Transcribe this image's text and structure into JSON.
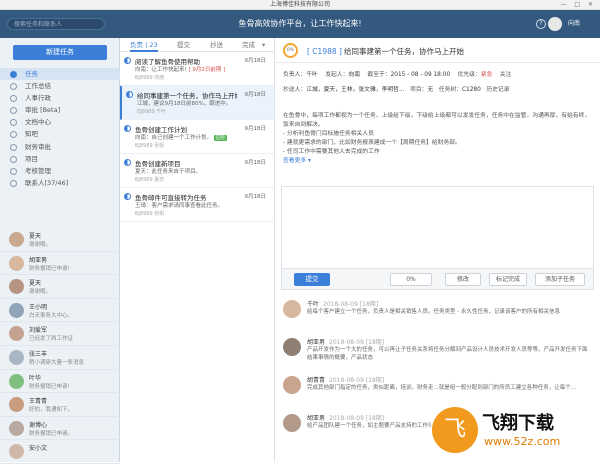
{
  "window": {
    "title": "上海博佳科技有限公司",
    "controls": "— □ ✕"
  },
  "topbar": {
    "search_placeholder": "搜索任务和联系人",
    "slogan": "鱼骨高效协作平台，让工作快起来!",
    "user_name": "向南",
    "help_glyph": "?"
  },
  "sidebar": {
    "new_task": "新建任务",
    "nav": [
      {
        "label": "任务",
        "active": true
      },
      {
        "label": "工作总结"
      },
      {
        "label": "人事行政"
      },
      {
        "label": "审批 [Beta]"
      },
      {
        "label": "文档中心"
      },
      {
        "label": "知吧"
      },
      {
        "label": "财务审批"
      },
      {
        "label": "项目"
      },
      {
        "label": "考核管理"
      },
      {
        "label": "联系人[37/46]"
      }
    ],
    "contacts": [
      {
        "name": "夏天",
        "msg": "谢谢哦。",
        "color": "#c9a98f"
      },
      {
        "name": "胡亚男",
        "msg": "财务报销已申请!",
        "color": "#d8b9a0"
      },
      {
        "name": "夏天",
        "msg": "谢谢哦。",
        "color": "#b89583"
      },
      {
        "name": "王小明",
        "msg": "白天事务大中心。",
        "color": "#8fa5b7"
      },
      {
        "name": "刘爱军",
        "msg": "已经发了两工作证",
        "color": "#c4a491"
      },
      {
        "name": "张三丰",
        "msg": "稍小调研大量一条消息",
        "color": "#a9b6c4"
      },
      {
        "name": "叶华",
        "msg": "财务报销已申请!",
        "color": "#7fbf7f"
      },
      {
        "name": "王青青",
        "msg": "好的，我通知下。",
        "color": "#c99b7f"
      },
      {
        "name": "谢博心",
        "msg": "财务报销已申请。",
        "color": "#b7a8a0"
      },
      {
        "name": "安小文",
        "msg": "",
        "color": "#d0b8a8"
      }
    ]
  },
  "tasks_panel": {
    "tabs": [
      "负责 | 23",
      "提交",
      "抄送",
      "完成"
    ],
    "tab_arrow": "▾",
    "items": [
      {
        "title": "阅读了解鱼骨使用帮助",
        "date": "9月18日",
        "sub": "向南：让工作快起来!",
        "tag": "[ 9月2日前期 ]",
        "id": "BJ8989 向南"
      },
      {
        "title": "给同事建第一个任务，协作马上开始",
        "date": "9月18日",
        "sub": "江城，建议9月18日前80%，跟进中。",
        "tag": "",
        "id": "BJ8989 千叶"
      },
      {
        "title": "鱼骨创建工作计划",
        "date": "9月18日",
        "sub": "向南：自己创建一个工作计划。",
        "tag": "已完",
        "id": "BJ8989 张帆"
      },
      {
        "title": "鱼骨创建新项目",
        "date": "9月18日",
        "sub": "夏天：此任务来自于项目。",
        "tag": "",
        "id": "BJ8989 夏天"
      },
      {
        "title": "鱼骨邮件可直接转为任务",
        "date": "9月18日",
        "sub": "王琦：客户需求请同事查看此任务。",
        "tag": "",
        "id": "BJ8989 张帆"
      }
    ]
  },
  "detail": {
    "progress": "0%",
    "code": "[ C1988 ]",
    "title": "给同事建第一个任务，协作马上开始",
    "row1": {
      "owner_l": "负责人：",
      "owner": "千叶",
      "creator_l": "发起人：",
      "creator": "向南",
      "deadline_l": "截至于：",
      "deadline": "2015 - 08 - 09 18:00",
      "priority_l": "优先级：",
      "priority": "紧急",
      "follow": "关注"
    },
    "row2": {
      "cc_l": "抄送人：",
      "cc": "江城，夏天，王林，张文雅，李明哲...",
      "project_l": "项目：",
      "project": "无",
      "rank_l": "任务树：",
      "rank": "C1280",
      "history": "历史记录"
    },
    "desc_lines": [
      "在鱼骨中，每项工作都视为一个任务，上级给下级，下级给上级都可以发发任务，任务中在监管，沟通再厚，有始有终，饭来自到解决。",
      "- 分析利鱼骨门目标施任务相关人员",
      "- 建就更需求的部门，比如财务报表建成一个【周期任务】给财务部。",
      "- 任司工作中需要其他人去完成的工作"
    ],
    "more": "查看更多 ▾",
    "submit": "提交",
    "progress_select": "0%",
    "modify": "修改",
    "mark_done": "标记完成",
    "add_subtask": "添加子任务",
    "comments": [
      {
        "name": "千叶",
        "time": "2018-08-09 [18期]",
        "text": "给每个客户建立一个任务，负责人是相关销售人员。任务类型 - 永久性任务，记录该客户的所有相关信息",
        "color": "#d6b79f"
      },
      {
        "name": "胡亚男",
        "time": "2018-08-09 [18期]",
        "text": "产品开发作为一个大的任务，可以再让子任务关系将任务分解到产品设计人员技术开发人员等等。产品开发任务下面结果事情的概要，产品状态",
        "color": "#8e7f75"
      },
      {
        "name": "胡青青",
        "time": "2018-08-09 [18期]",
        "text": "完成其他部门指定的任务，类似距离，培训，财务走...就是组一般分配到部门的所员工建立各种任务，让每个...",
        "color": "#c9a48e"
      },
      {
        "name": "胡亚男",
        "time": "2018-08-09 [18期]",
        "text": "给产品团队建一个任务，如主题要产品支持的工作事项",
        "color": "#b29989"
      }
    ]
  },
  "watermark": {
    "logo_glyph": "飞",
    "title": "飞翔下载",
    "url": "www.52z.com"
  }
}
